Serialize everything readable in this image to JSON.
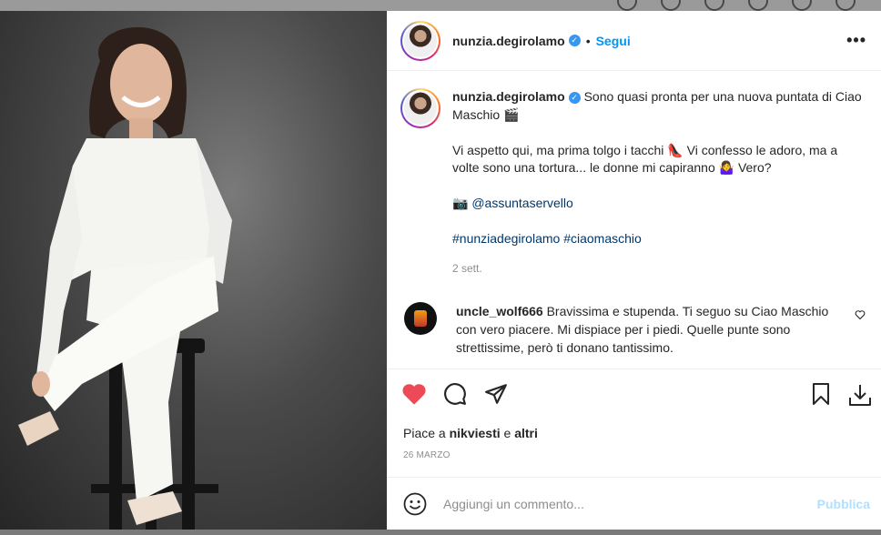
{
  "post": {
    "username": "nunzia.degirolamo",
    "follow_label": "Segui",
    "dot": "•",
    "more_label": "•••",
    "verified_mark": "✓"
  },
  "caption": {
    "username": "nunzia.degirolamo",
    "line1": "Sono quasi pronta per una nuova puntata di Ciao Maschio 🎬",
    "line2": "Vi aspetto qui, ma prima tolgo i tacchi 👠 Vi confesso le adoro, ma a volte sono una tortura... le donne mi capiranno 🤷‍♀️ Vero?",
    "tag_prefix": "📷",
    "tag": "@assuntaservello",
    "hashtags": "#nunziadegirolamo #ciaomaschio",
    "time": "2 sett."
  },
  "comment": {
    "username": "uncle_wolf666",
    "text": "Bravissima e stupenda. Ti seguo su Ciao Maschio con vero piacere. Mi dispiace per i piedi. Quelle punte sono strettissime, però ti donano tantissimo."
  },
  "likes": {
    "prefix": "Piace a ",
    "user": "nikviesti",
    "suffix": " e ",
    "others": "altri"
  },
  "date": "26 MARZO",
  "add_comment": {
    "placeholder": "Aggiungi un commento...",
    "publish_label": "Pubblica"
  },
  "colors": {
    "like_red": "#ed4956",
    "link_blue": "#00376b",
    "follow_blue": "#0095f6",
    "publish_disabled": "#b2dffc"
  },
  "icons": [
    "heart-filled-icon",
    "comment-icon",
    "share-icon",
    "bookmark-icon",
    "download-icon",
    "emoji-icon",
    "comment-heart-icon",
    "verified-badge-icon",
    "more-options-icon"
  ]
}
